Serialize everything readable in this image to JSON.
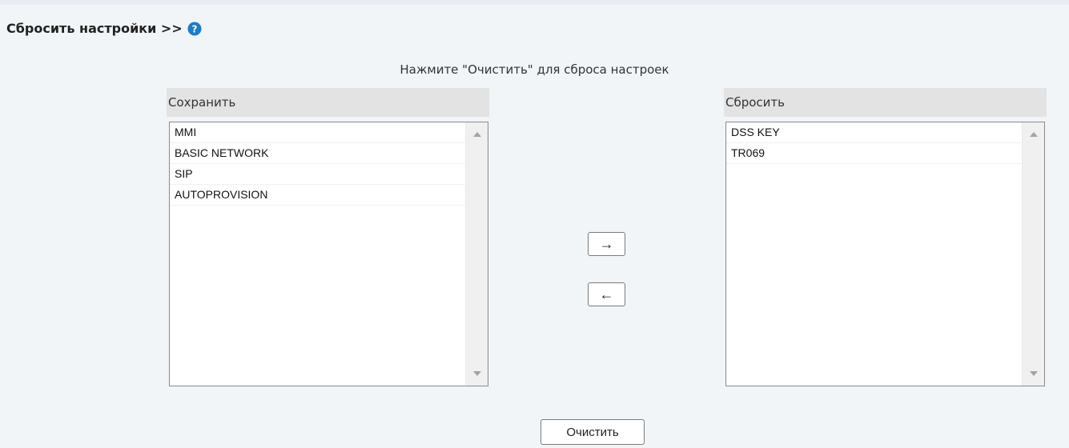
{
  "section": {
    "title": "Сбросить настройки >>",
    "help_icon": "question-circle-icon",
    "hint": "Нажмите \"Очистить\" для сброса настроек"
  },
  "keep_list": {
    "header": "Сохранить",
    "items": [
      "MMI",
      "BASIC NETWORK",
      "SIP",
      "AUTOPROVISION"
    ]
  },
  "reset_list": {
    "header": "Сбросить",
    "items": [
      "DSS KEY",
      "TR069"
    ]
  },
  "buttons": {
    "move_right": "→",
    "move_left": "←",
    "clear": "Очистить"
  },
  "colors": {
    "background": "#f1f5f8",
    "header_bg": "#e3e3e3",
    "help_icon": "#1d7bc9"
  }
}
